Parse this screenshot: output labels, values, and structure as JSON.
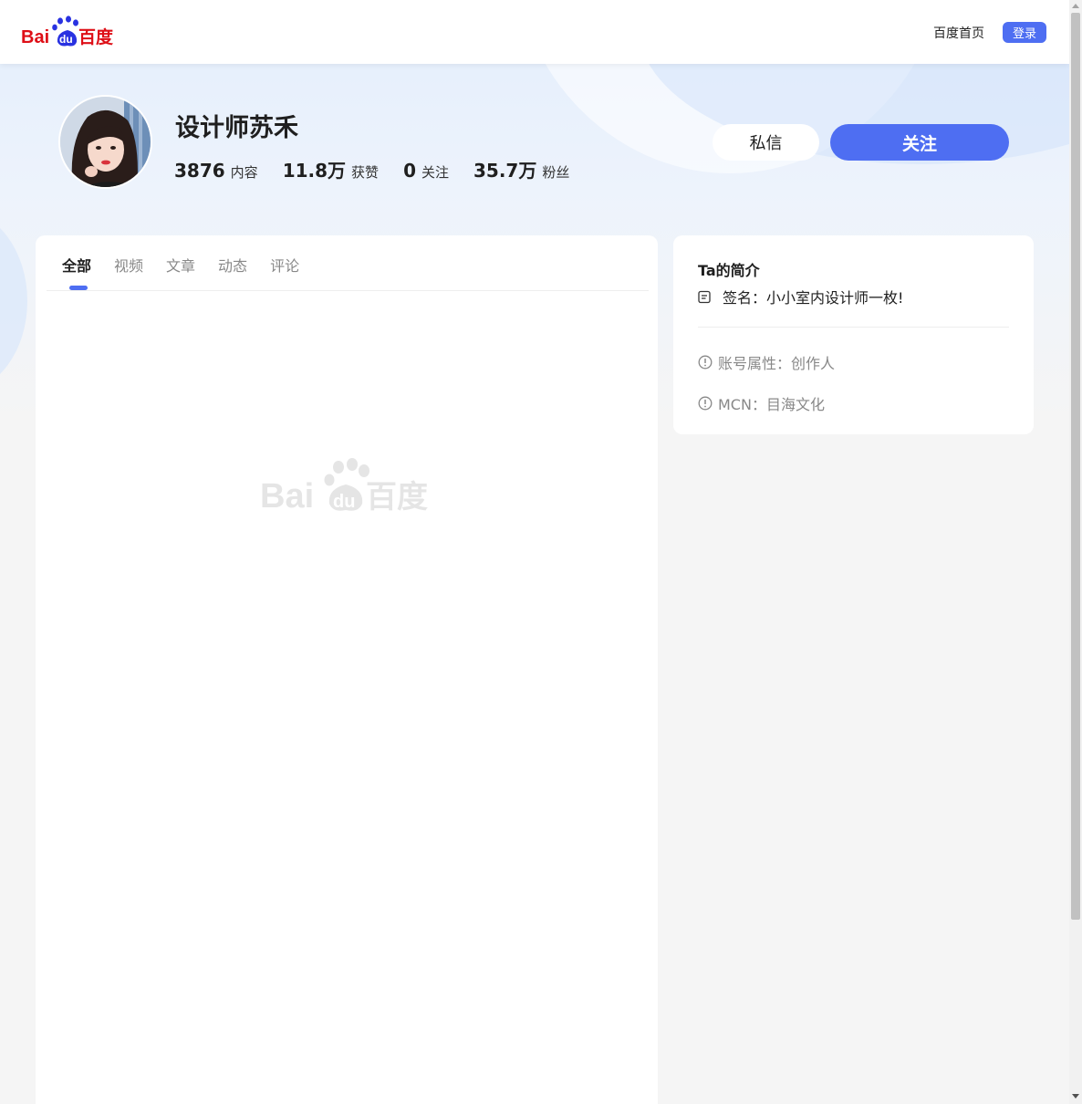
{
  "header": {
    "logo_text_bai": "Bai",
    "logo_text_du": "du",
    "logo_text_cn": "百度",
    "home_link": "百度首页",
    "login_label": "登录"
  },
  "profile": {
    "name": "设计师苏禾",
    "stats": [
      {
        "value": "3876",
        "label": "内容"
      },
      {
        "value": "11.8万",
        "label": "获赞"
      },
      {
        "value": "0",
        "label": "关注"
      },
      {
        "value": "35.7万",
        "label": "粉丝"
      }
    ],
    "message_label": "私信",
    "follow_label": "关注"
  },
  "tabs": [
    {
      "label": "全部",
      "active": true
    },
    {
      "label": "视频",
      "active": false
    },
    {
      "label": "文章",
      "active": false
    },
    {
      "label": "动态",
      "active": false
    },
    {
      "label": "评论",
      "active": false
    }
  ],
  "intro": {
    "title": "Ta的简介",
    "signature": "签名：小小室内设计师一枚!",
    "account_type": "账号属性：创作人",
    "mcn": "MCN：目海文化"
  },
  "watermark": {
    "text_bai": "Bai",
    "text_du": "du",
    "text_cn": "百度"
  },
  "colors": {
    "accent": "#4e6ef2",
    "brand_red": "#de0f17",
    "brand_blue": "#2932e1"
  }
}
